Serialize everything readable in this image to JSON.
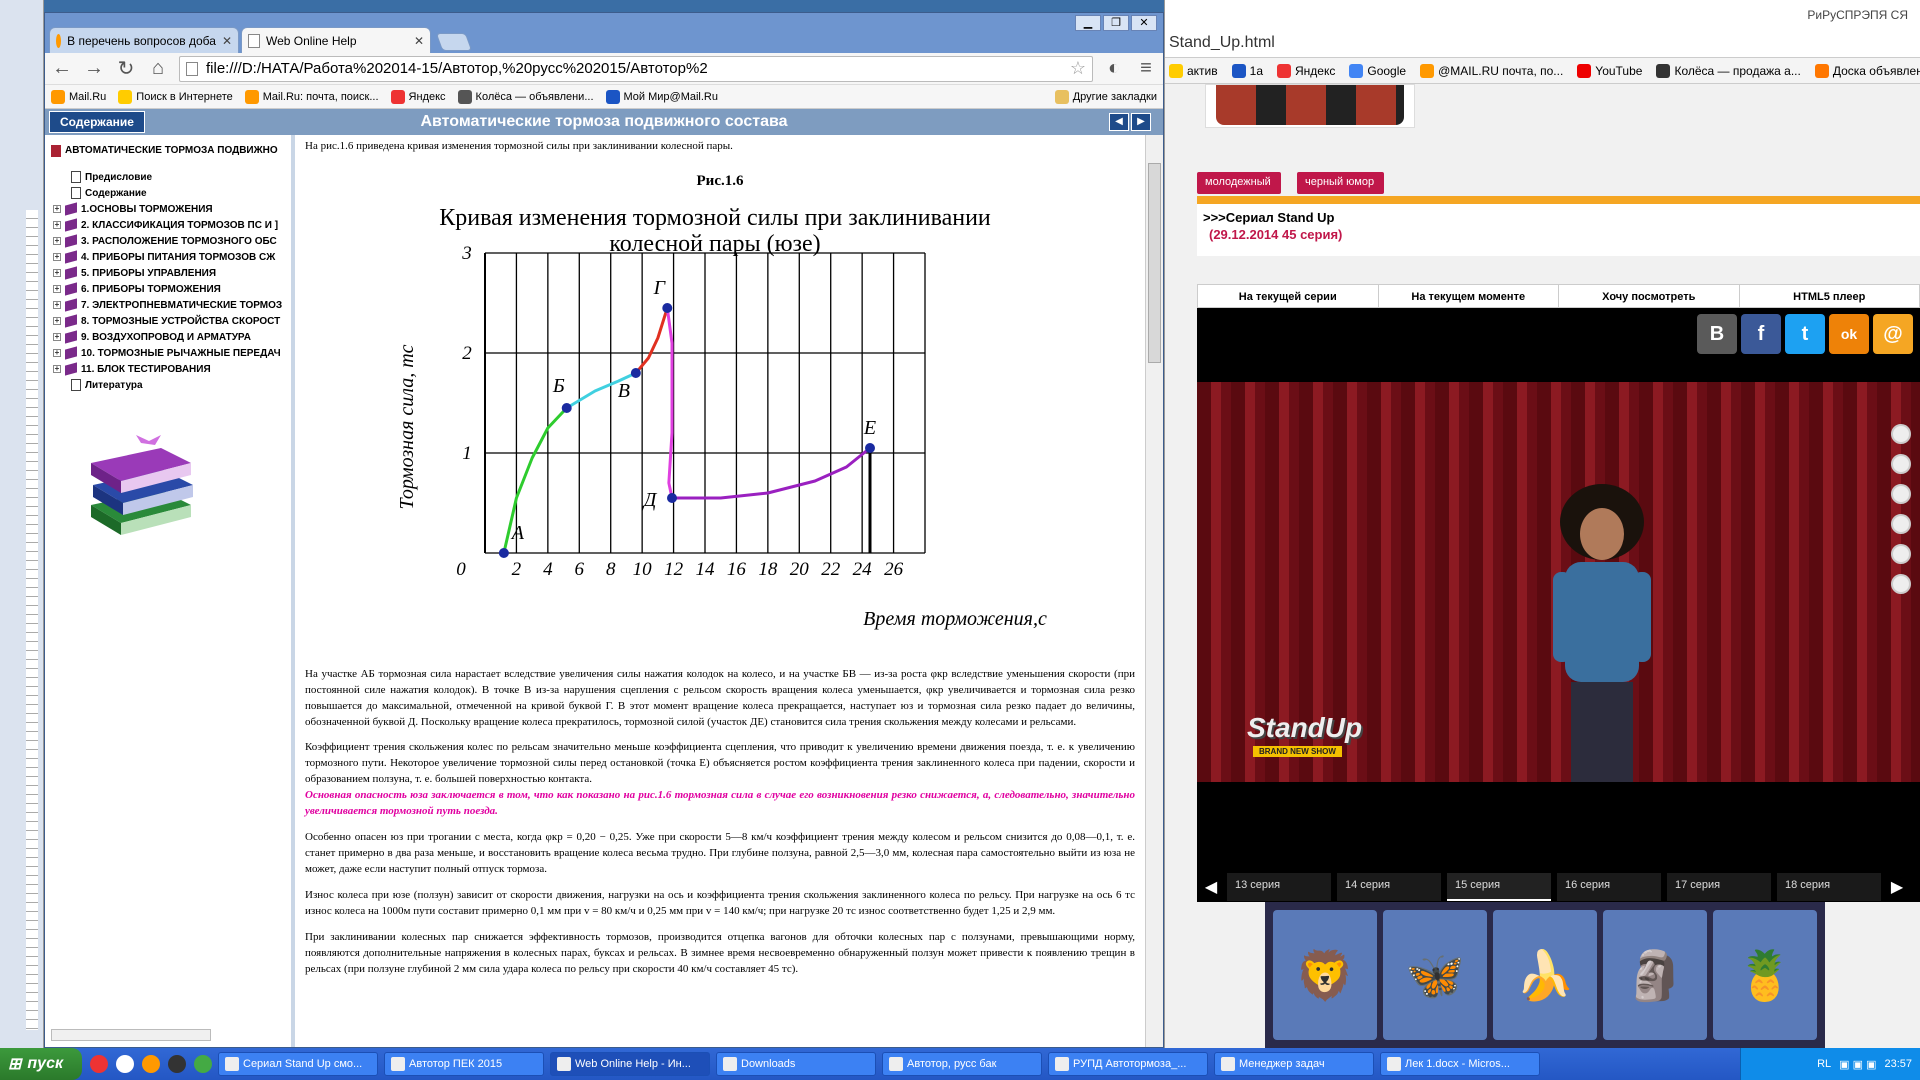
{
  "background_window": {
    "title_fragment": "РиРуСПРЭПЯ СЯ",
    "url_fragment": "Stand_Up.html",
    "bookmarks": [
      "актив",
      "1а",
      "Яндекс",
      "Google",
      "@MAIL.RU почта, по...",
      "YouTube",
      "Колёса — продажа а...",
      "Доска объявлений Ol..."
    ],
    "tags": [
      "молодежный",
      "черный юмор"
    ],
    "show_title": ">>>Сериал Stand Up",
    "show_subtitle": "(29.12.2014 45 серия)",
    "player_tabs": [
      "На текущей серии",
      "На текущем моменте",
      "Хочу посмотреть",
      "HTML5 плеер"
    ],
    "share_buttons": [
      "B",
      "f",
      "t",
      "ok",
      "@"
    ],
    "episodes": [
      "13 серия",
      "14 серия",
      "15 серия",
      "16 серия",
      "17 серия",
      "18 серия"
    ],
    "current_episode": "15 серия",
    "logo_text": "StandUp",
    "logo_sub": "BRAND NEW SHOW"
  },
  "browser": {
    "tabs": [
      {
        "label": "В перечень вопросов доба",
        "active": false
      },
      {
        "label": "Web Online Help",
        "active": true
      }
    ],
    "url": "file:///D:/НАТА/Работа%202014-15/Автотор,%20русс%202015/Автотор%2",
    "bookmarks": [
      "Mail.Ru",
      "Поиск в Интернете",
      "Mail.Ru: почта, поиск...",
      "Яндекс",
      "Колёса — объявлени...",
      "Мой Мир@Mail.Ru"
    ],
    "other_bookmarks": "Другие закладки"
  },
  "help": {
    "contents_button": "Содержание",
    "title": "Автоматические тормоза подвижного состава",
    "toc_root": "АВТОМАТИЧЕСКИЕ ТОРМОЗА ПОДВИЖНО",
    "toc": [
      {
        "label": "Предисловие",
        "kind": "page"
      },
      {
        "label": "Содержание",
        "kind": "page"
      },
      {
        "label": "1.ОСНОВЫ ТОРМОЖЕНИЯ",
        "kind": "book"
      },
      {
        "label": "2. КЛАССИФИКАЦИЯ ТОРМОЗОВ ПС И ]",
        "kind": "book"
      },
      {
        "label": "3. РАСПОЛОЖЕНИЕ ТОРМОЗНОГО ОБС",
        "kind": "book"
      },
      {
        "label": "4. ПРИБОРЫ ПИТАНИЯ ТОРМОЗОВ СЖ",
        "kind": "book"
      },
      {
        "label": "5. ПРИБОРЫ УПРАВЛЕНИЯ",
        "kind": "book"
      },
      {
        "label": "6. ПРИБОРЫ ТОРМОЖЕНИЯ",
        "kind": "book"
      },
      {
        "label": "7. ЭЛЕКТРОПНЕВМАТИЧЕСКИЕ ТОРМОЗ",
        "kind": "book"
      },
      {
        "label": "8. ТОРМОЗНЫЕ УСТРОЙСТВА СКОРОСТ",
        "kind": "book"
      },
      {
        "label": "9. ВОЗДУХОПРОВОД И АРМАТУРА",
        "kind": "book"
      },
      {
        "label": "10. ТОРМОЗНЫЕ РЫЧАЖНЫЕ ПЕРЕДАЧ",
        "kind": "book"
      },
      {
        "label": "11. БЛОК ТЕСТИРОВАНИЯ",
        "kind": "book"
      },
      {
        "label": "Литература",
        "kind": "page"
      }
    ],
    "intro": "На рис.1.6 приведена кривая изменения тормозной силы при заклинивании колесной пары.",
    "figure_caption": "Рис.1.6",
    "paragraphs": [
      "На участке АБ тормозная сила нарастает вследствие увеличения силы нажатия колодок на колесо, и на участке БВ — из-за роста φкр вследствие уменьшения скорости (при постоянной силе нажатия колодок). В точке В из-за нарушения сцепления с рельсом скорость вращения колеса уменьшается, φкр увеличивается и тормозная сила резко повышается до максимальной, отмеченной на кривой буквой Г. В этот момент вращение колеса прекращается, наступает юз и тормозная сила резко падает до величины, обозначенной буквой Д. Поскольку вращение колеса прекратилось, тормозной силой (участок ДЕ) становится сила трения скольжения между колесами и рельсами.",
      "Коэффициент трения скольжения колес по рельсам значительно меньше коэффициента сцепления, что приводит к увеличению времени движения поезда, т. е. к увеличению тормозного пути. Некоторое увеличение тормозной силы перед остановкой (точка Е) объясняется ростом коэффициента трения заклиненного колеса при падении, скорости и образованием ползуна, т. е. большей поверхностью контакта."
    ],
    "warning": "Основная опасность юза заключается в том, что как показано на рис.1.6 тормозная сила в случае его возникновения резко снижается, а, следовательно, значительно увеличивается тормозной путь поезда.",
    "paragraphs2": [
      "Особенно опасен юз при трогании с места, когда φкр = 0,20 − 0,25. Уже при скорости 5—8 км/ч коэффициент трения между колесом и рельсом снизится до 0,08—0,1, т. е. станет примерно в два раза меньше, и восстановить вращение колеса весьма трудно. При глубине ползуна, равной 2,5—3,0 мм, колесная пара самостоятельно выйти из юза не может, даже если наступит полный отпуск тормоза.",
      "Износ колеса при юзе (ползун) зависит от скорости движения, нагрузки на ось и коэффициента трения скольжения заклиненного колеса по рельсу. При нагрузке на ось 6 тс износ колеса на 1000м пути составит примерно 0,1 мм при v = 80 км/ч и 0,25 мм при v = 140 км/ч; при нагрузке 20 тс износ соответственно будет 1,25 и 2,9 мм.",
      "При заклинивании колесных пар снижается эффективность тормозов, производится отцепка вагонов для обточки колесных пар с ползунами, превышающими норму, появляются дополнительные напряжения в колесных парах, буксах и рельсах. В зимнее время несвоевременно обнаруженный ползун может привести к появлению трещин в рельсах (при ползуне глубиной 2 мм сила удара колеса по рельсу при скорости 40 км/ч составляет 45 тс)."
    ]
  },
  "chart_data": {
    "type": "line",
    "title": "Кривая изменения тормозной силы при заклинивании колесной пары (юзе)",
    "xlabel": "Время торможения,с",
    "ylabel": "Тормозная сила, тс",
    "xlim": [
      0,
      28
    ],
    "ylim": [
      0,
      3
    ],
    "xticks": [
      0,
      2,
      4,
      6,
      8,
      10,
      12,
      14,
      16,
      18,
      20,
      22,
      24,
      26
    ],
    "yticks": [
      0,
      1,
      2,
      3
    ],
    "grid": true,
    "points": [
      {
        "label": "А",
        "x": 1.2,
        "y": 0.0
      },
      {
        "label": "Б",
        "x": 5.2,
        "y": 1.45
      },
      {
        "label": "В",
        "x": 9.6,
        "y": 1.8
      },
      {
        "label": "Г",
        "x": 11.6,
        "y": 2.45
      },
      {
        "label": "Д",
        "x": 11.9,
        "y": 0.55
      },
      {
        "label": "Е",
        "x": 24.5,
        "y": 1.05
      }
    ],
    "series": [
      {
        "color": "#2ecc2e",
        "x": [
          1.2,
          2.0,
          3.0,
          4.0,
          5.2
        ],
        "y": [
          0.0,
          0.55,
          0.95,
          1.25,
          1.45
        ]
      },
      {
        "color": "#40d0e0",
        "x": [
          5.2,
          7.0,
          8.5,
          9.6
        ],
        "y": [
          1.45,
          1.62,
          1.72,
          1.8
        ]
      },
      {
        "color": "#e03020",
        "x": [
          9.6,
          10.4,
          11.0,
          11.6
        ],
        "y": [
          1.8,
          1.95,
          2.15,
          2.45
        ]
      },
      {
        "color": "#e040e0",
        "x": [
          11.6,
          11.9,
          11.9,
          11.7,
          11.9
        ],
        "y": [
          2.45,
          2.1,
          1.2,
          0.7,
          0.55
        ]
      },
      {
        "color": "#9a20c0",
        "x": [
          11.9,
          15.0,
          18.0,
          21.0,
          23.0,
          24.5
        ],
        "y": [
          0.55,
          0.55,
          0.6,
          0.72,
          0.86,
          1.05
        ]
      }
    ]
  },
  "taskbar": {
    "start": "пуск",
    "tasks": [
      "Сериал Stand Up смо...",
      "Автотор ПЕК 2015",
      "Web Online Help - Ин...",
      "Downloads",
      "Автотор, русс бак",
      "РУПД Автотормоза_...",
      "Менеджер задач",
      "Лек 1.docx - Micros..."
    ],
    "active_task": "Web Online Help - Ин...",
    "lang": "RL",
    "time": "23:57"
  },
  "colors": {
    "accent_help": "#1e4b8a",
    "highlight": "#e000a0",
    "taskbar": "#2457c4"
  }
}
